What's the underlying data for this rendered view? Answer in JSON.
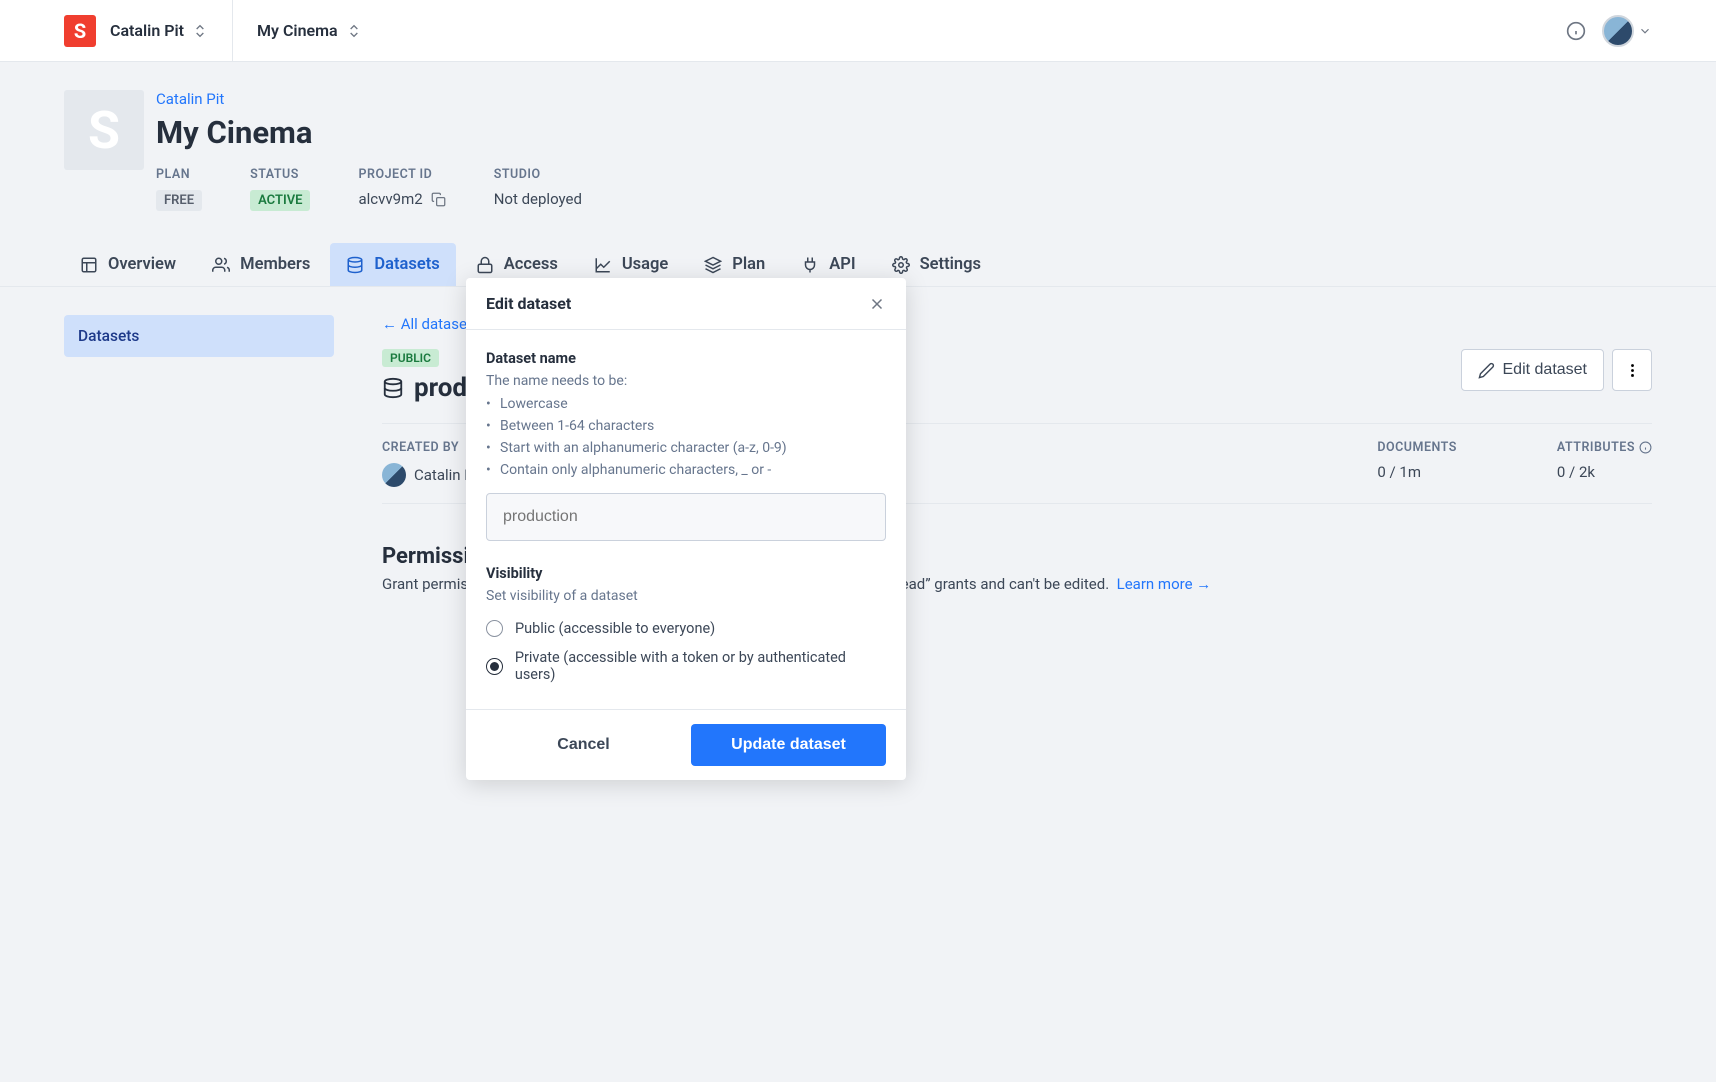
{
  "topbar": {
    "logo": "S",
    "org": "Catalin Pit",
    "project": "My Cinema"
  },
  "breadcrumb": "Catalin Pit",
  "project_title": "My Cinema",
  "project_avatar": "S",
  "meta": {
    "plan_label": "PLAN",
    "plan_value": "FREE",
    "status_label": "STATUS",
    "status_value": "ACTIVE",
    "project_id_label": "PROJECT ID",
    "project_id_value": "alcvv9m2",
    "studio_label": "STUDIO",
    "studio_value": "Not deployed"
  },
  "tabs": {
    "overview": "Overview",
    "members": "Members",
    "datasets": "Datasets",
    "access": "Access",
    "usage": "Usage",
    "plan": "Plan",
    "api": "API",
    "settings": "Settings"
  },
  "sidebar": {
    "datasets": "Datasets"
  },
  "main": {
    "back": "← All datasets",
    "badge": "PUBLIC",
    "title": "production",
    "edit_button": "Edit dataset",
    "created_by_label": "CREATED BY",
    "created_by_value": "Catalin Pit",
    "documents_label": "DOCUMENTS",
    "documents_value": "0 / 1m",
    "attributes_label": "ATTRIBUTES",
    "attributes_value": "0 / 2k",
    "perm_title": "Permissions",
    "perm_desc_pre": "Grant permissions on a dataset level. Note that “everyone” can only be given “read” grants and can't be edited.",
    "learn_more": "Learn more →"
  },
  "modal": {
    "title": "Edit dataset",
    "name_label": "Dataset name",
    "name_hint": "The name needs to be:",
    "rules": [
      "Lowercase",
      "Between 1-64 characters",
      "Start with an alphanumeric character (a-z, 0-9)",
      "Contain only alphanumeric characters, _ or -"
    ],
    "name_placeholder": "production",
    "visibility_label": "Visibility",
    "visibility_hint": "Set visibility of a dataset",
    "option_public": "Public (accessible to everyone)",
    "option_private": "Private (accessible with a token or by authenticated users)",
    "cancel": "Cancel",
    "submit": "Update dataset",
    "selected": "private"
  }
}
